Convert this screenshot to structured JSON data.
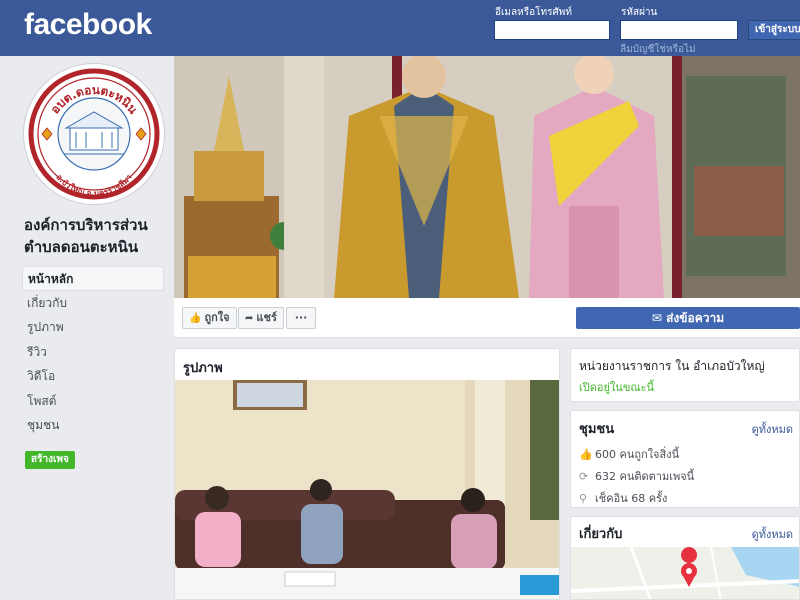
{
  "header": {
    "logo": "facebook",
    "email_label": "อีเมลหรือโทรศัพท์",
    "password_label": "รหัสผ่าน",
    "login_button": "เข้าสู่ระบบ",
    "forgot_link": "ลืมบัญชีใช่หรือไม่"
  },
  "page": {
    "name": "องค์การบริหารส่วนตำบลดอนตะหนิน",
    "logo_top_text": "อบต.ดอนตะหนิน",
    "logo_bottom_text": "อ.บัวใหญ่ จ.นครราชสีมา"
  },
  "sidebar": {
    "items": [
      {
        "label": "หน้าหลัก",
        "active": true
      },
      {
        "label": "เกี่ยวกับ"
      },
      {
        "label": "รูปภาพ"
      },
      {
        "label": "รีวิว"
      },
      {
        "label": "วิดีโอ"
      },
      {
        "label": "โพสต์"
      },
      {
        "label": "ชุมชน"
      }
    ],
    "create_page": "สร้างเพจ"
  },
  "actions": {
    "like": "ถูกใจ",
    "share": "แชร์",
    "more": "···",
    "message": "ส่งข้อความ"
  },
  "photos": {
    "title": "รูปภาพ"
  },
  "info": {
    "category": "หน่วยงานราชการ ใน อำเภอบัวใหญ่",
    "status": "เปิดอยู่ในขณะนี้"
  },
  "community": {
    "title": "ชุมชน",
    "see_all": "ดูทั้งหมด",
    "likes": "600 คนถูกใจสิ่งนี้",
    "followers": "632 คนติดตามเพจนี้",
    "checkins": "เช็คอิน 68 ครั้ง"
  },
  "about": {
    "title": "เกี่ยวกับ",
    "see_all": "ดูทั้งหมด"
  },
  "colors": {
    "brand": "#3b5998",
    "button_blue": "#4267b2",
    "create_green": "#42b72a",
    "link": "#385898"
  }
}
